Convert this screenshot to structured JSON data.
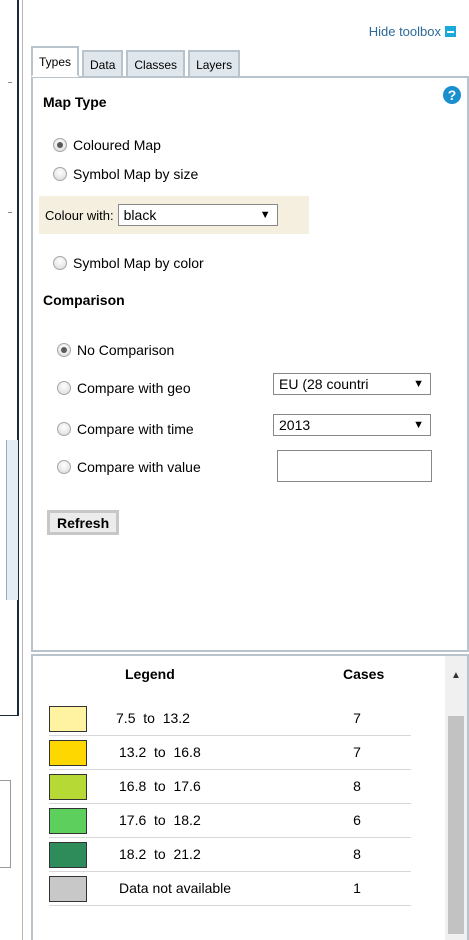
{
  "toolbox": {
    "hide_label": "Hide toolbox",
    "tabs": [
      {
        "label": "Types",
        "active": true
      },
      {
        "label": "Data",
        "active": false
      },
      {
        "label": "Classes",
        "active": false
      },
      {
        "label": "Layers",
        "active": false
      }
    ]
  },
  "types": {
    "map_type_heading": "Map Type",
    "help_label": "?",
    "options": {
      "coloured": {
        "label": "Coloured Map",
        "checked": true
      },
      "symbol_size": {
        "label": "Symbol Map by size",
        "checked": false
      },
      "symbol_color": {
        "label": "Symbol Map by color",
        "checked": false
      }
    },
    "colour_with": {
      "label": "Colour with:",
      "value": "black"
    },
    "comparison_heading": "Comparison",
    "comparison": {
      "none": {
        "label": "No Comparison",
        "checked": true
      },
      "geo": {
        "label": "Compare with geo",
        "value": "EU (28 countri"
      },
      "time": {
        "label": "Compare with time",
        "value": "2013"
      },
      "value": {
        "label": "Compare with value",
        "value": ""
      }
    },
    "refresh_label": "Refresh"
  },
  "legend": {
    "header_legend": "Legend",
    "header_cases": "Cases",
    "rows": [
      {
        "label": "7.5  to  13.2",
        "cases": "7",
        "color": "#fff2a0"
      },
      {
        "label": "13.2  to  16.8",
        "cases": "7",
        "color": "#ffd700"
      },
      {
        "label": "16.8  to  17.6",
        "cases": "8",
        "color": "#b6d935"
      },
      {
        "label": "17.6  to  18.2",
        "cases": "6",
        "color": "#5dcf5d"
      },
      {
        "label": "18.2  to  21.2",
        "cases": "8",
        "color": "#2e8b5a"
      },
      {
        "label": "Data not available",
        "cases": "1",
        "color": "#c8c8c8"
      }
    ]
  },
  "icons": {
    "hide": "minus-box-icon",
    "help": "help-icon",
    "dropdown": "triangle-down-icon",
    "scroll_up": "triangle-up-icon"
  }
}
